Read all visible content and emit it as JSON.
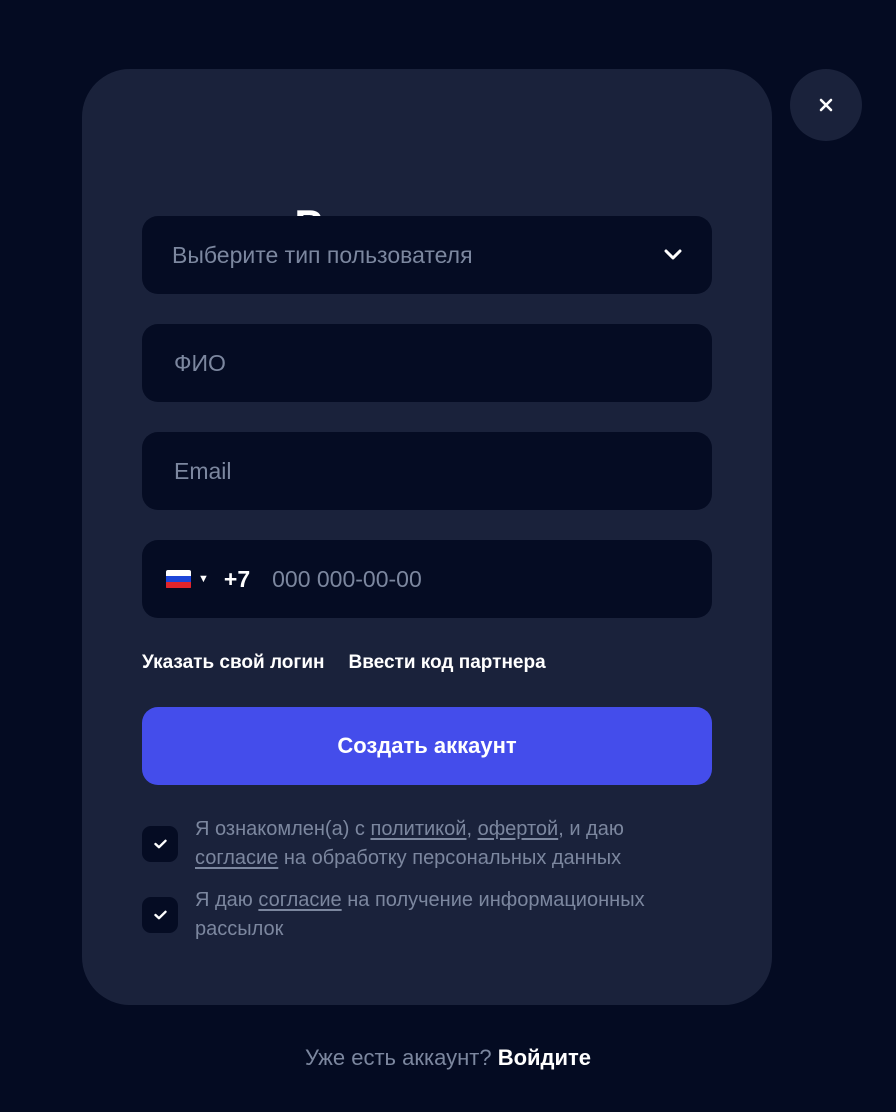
{
  "modal": {
    "title": "Регистрация",
    "user_type_select": {
      "placeholder": "Выберите тип пользователя"
    },
    "name_field": {
      "placeholder": "ФИО",
      "value": ""
    },
    "email_field": {
      "placeholder": "Email",
      "value": ""
    },
    "phone_field": {
      "country_flag": "russia-flag-icon",
      "country_code": "+7",
      "placeholder": "000 000-00-00",
      "value": ""
    },
    "links": {
      "custom_login": "Указать свой логин",
      "partner_code": "Ввести код партнера"
    },
    "submit_label": "Создать аккаунт",
    "consents": [
      {
        "checked": true,
        "parts": {
          "t1": "Я ознакомлен(а) с ",
          "link1": "политикой",
          "t2": ", ",
          "link2": "офертой",
          "t3": ", и даю ",
          "link3": "согласие",
          "t4": " на обработку персональных данных"
        }
      },
      {
        "checked": true,
        "parts": {
          "t1": "Я даю ",
          "link1": "согласие",
          "t2": " на получение информационных рассылок"
        }
      }
    ]
  },
  "close_icon": "close-icon",
  "footer": {
    "question": "Уже есть аккаунт?",
    "login_link": "Войдите"
  },
  "colors": {
    "background": "#040b22",
    "modal": "#1a223b",
    "field": "#050c23",
    "accent": "#444deb",
    "muted_text": "#7c879f"
  }
}
